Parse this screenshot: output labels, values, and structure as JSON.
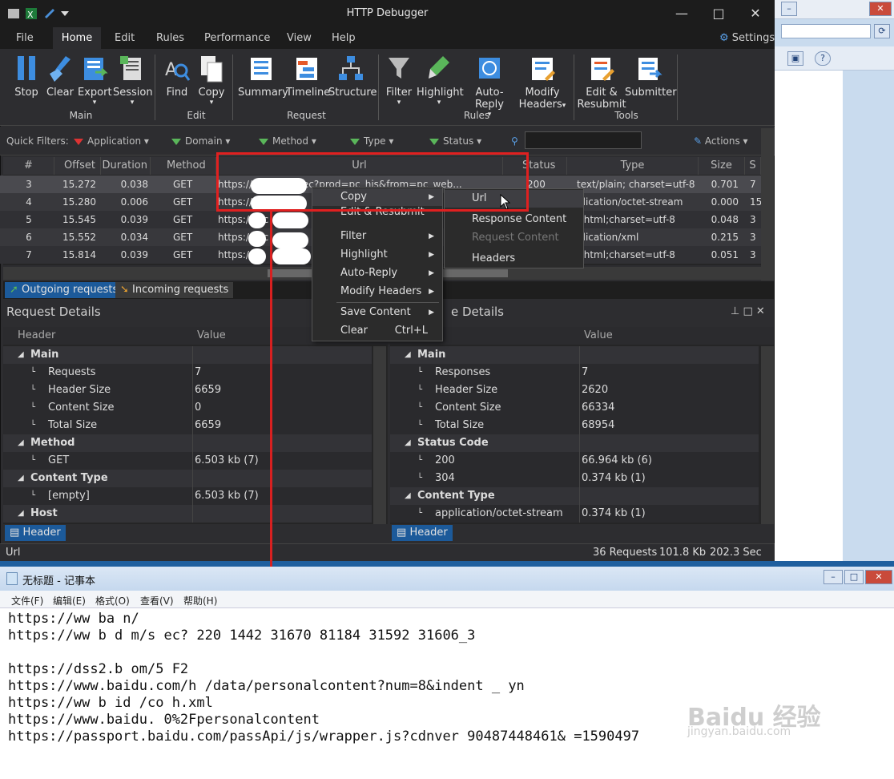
{
  "app": {
    "title": "HTTP Debugger"
  },
  "menu": {
    "file": "File",
    "home": "Home",
    "edit": "Edit",
    "rules": "Rules",
    "performance": "Performance",
    "view": "View",
    "help": "Help",
    "settings": "Settings"
  },
  "ribbon": {
    "stop": "Stop",
    "clear": "Clear",
    "export": "Export",
    "session": "Session",
    "find": "Find",
    "copy": "Copy",
    "summary": "Summary",
    "timeline": "Timeline",
    "structure": "Structure",
    "filter": "Filter",
    "highlight": "Highlight",
    "autoreply": "Auto-Reply",
    "modify1": "Modify",
    "modify2": "Headers",
    "editres1": "Edit &",
    "editres2": "Resubmit",
    "submitter": "Submitter",
    "groups": {
      "main": "Main",
      "edit": "Edit",
      "request": "Request",
      "rules": "Rules",
      "tools": "Tools"
    }
  },
  "quick_filters": {
    "label": "Quick Filters:",
    "application": "Application",
    "domain": "Domain",
    "method": "Method",
    "type": "Type",
    "status": "Status",
    "actions": "Actions"
  },
  "grid": {
    "columns": {
      "num": "#",
      "offset": "Offset",
      "duration": "Duration",
      "method": "Method",
      "url": "Url",
      "status": "Status",
      "type": "Type",
      "size": "Size",
      "s": "S"
    },
    "rows": [
      {
        "num": "3",
        "offset": "15.272",
        "duration": "0.038",
        "method": "GET",
        "url": "https://w                     om/sugrec?prod=pc_his&from=pc_web...",
        "status": "200",
        "type": "text/plain; charset=utf-8",
        "size": "0.701",
        "s": "7"
      },
      {
        "num": "4",
        "offset": "15.280",
        "duration": "0.006",
        "method": "GET",
        "url": "https://d",
        "status": "",
        "type": "plication/octet-stream",
        "size": "0.000",
        "s": "15"
      },
      {
        "num": "5",
        "offset": "15.545",
        "duration": "0.039",
        "method": "GET",
        "url": "https://w                 c",
        "status": "",
        "type": "t/html;charset=utf-8",
        "size": "0.048",
        "s": "3"
      },
      {
        "num": "6",
        "offset": "15.552",
        "duration": "0.034",
        "method": "GET",
        "url": "https://w                 c",
        "status": "",
        "type": "plication/xml",
        "size": "0.215",
        "s": "3"
      },
      {
        "num": "7",
        "offset": "15.814",
        "duration": "0.039",
        "method": "GET",
        "url": "https://",
        "status": "",
        "type": "t/html;charset=utf-8",
        "size": "0.051",
        "s": "3"
      }
    ]
  },
  "tabs": {
    "outgoing": "Outgoing requests",
    "incoming": "Incoming requests"
  },
  "request_details": {
    "title": "Request Details",
    "col_header": "Header",
    "col_value": "Value",
    "tab": "Header",
    "rows": [
      {
        "label": "Main",
        "value": "",
        "level": 0
      },
      {
        "label": "Requests",
        "value": "7",
        "level": 1
      },
      {
        "label": "Header Size",
        "value": "6659",
        "level": 1
      },
      {
        "label": "Content Size",
        "value": "0",
        "level": 1
      },
      {
        "label": "Total Size",
        "value": "6659",
        "level": 1
      },
      {
        "label": "Method",
        "value": "",
        "level": 0
      },
      {
        "label": "GET",
        "value": "6.503 kb (7)",
        "level": 1
      },
      {
        "label": "Content Type",
        "value": "",
        "level": 0
      },
      {
        "label": "[empty]",
        "value": "6.503 kb (7)",
        "level": 1
      },
      {
        "label": "Host",
        "value": "",
        "level": 0
      }
    ]
  },
  "response_details": {
    "title": "e Details",
    "col_header": "Header",
    "col_value": "Value",
    "tab": "Header",
    "rows": [
      {
        "label": "Main",
        "value": "",
        "level": 0
      },
      {
        "label": "Responses",
        "value": "7",
        "level": 1
      },
      {
        "label": "Header Size",
        "value": "2620",
        "level": 1
      },
      {
        "label": "Content Size",
        "value": "66334",
        "level": 1
      },
      {
        "label": "Total Size",
        "value": "68954",
        "level": 1
      },
      {
        "label": "Status Code",
        "value": "",
        "level": 0
      },
      {
        "label": "200",
        "value": "66.964 kb (6)",
        "level": 1
      },
      {
        "label": "304",
        "value": "0.374 kb (1)",
        "level": 1
      },
      {
        "label": "Content Type",
        "value": "",
        "level": 0
      },
      {
        "label": "application/octet-stream",
        "value": "0.374 kb (1)",
        "level": 1
      }
    ]
  },
  "statusbar": {
    "left": "Url",
    "requests": "36 Requests",
    "size": "101.8 Kb",
    "time": "202.3 Sec"
  },
  "context_menu": {
    "copy": "Copy",
    "edit_resubmit": "Edit & Resubmit",
    "filter": "Filter",
    "highlight": "Highlight",
    "autoreply": "Auto-Reply",
    "modify": "Modify Headers",
    "save": "Save Content",
    "clear": "Clear",
    "clear_shortcut": "Ctrl+L"
  },
  "submenu": {
    "url": "Url",
    "response_content": "Response Content",
    "request_content": "Request Content",
    "headers": "Headers"
  },
  "notepad": {
    "title": "无标题 - 记事本",
    "menu": {
      "file": "文件(F)",
      "edit": "编辑(E)",
      "format": "格式(O)",
      "view": "查看(V)",
      "help": "帮助(H)"
    },
    "lines": [
      "https://ww  ba         n/",
      "https://ww  b  d     m/s    ec?                                    220 1442 31670 81184 31592 31606_3",
      "https://dss2.b       om/5                                                       F2",
      "https://www.baidu.com/h     /data/personalcontent?num=8&indent   _                          yn",
      "https://ww   b  id     /co           h.xml",
      "https://www.baidu.                                                          0%2Fpersonalcontent",
      "https://passport.baidu.com/passApi/js/wrapper.js?cdnver       90487448461& =1590497"
    ]
  },
  "watermark": {
    "brand": "Baidu 经验",
    "url": "jingyan.baidu.com"
  }
}
